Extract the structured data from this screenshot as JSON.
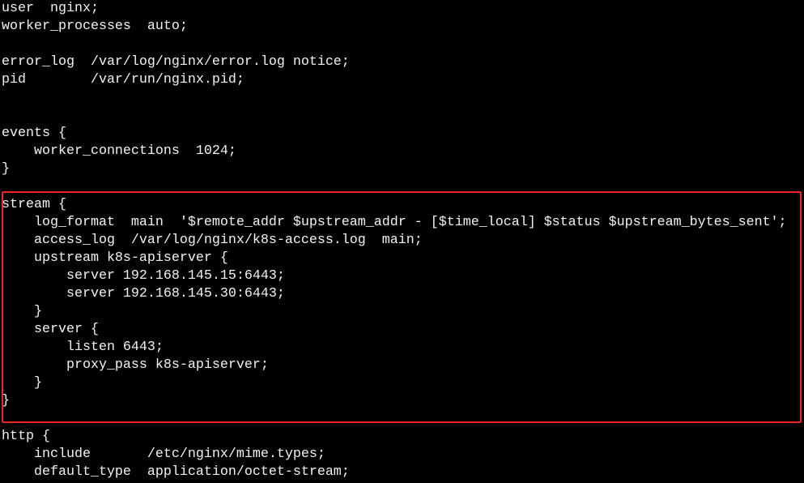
{
  "terminal": {
    "lines": [
      "user  nginx;",
      "worker_processes  auto;",
      "",
      "error_log  /var/log/nginx/error.log notice;",
      "pid        /var/run/nginx.pid;",
      "",
      "",
      "events {",
      "    worker_connections  1024;",
      "}",
      "",
      "stream {",
      "    log_format  main  '$remote_addr $upstream_addr - [$time_local] $status $upstream_bytes_sent';",
      "    access_log  /var/log/nginx/k8s-access.log  main;",
      "    upstream k8s-apiserver {",
      "        server 192.168.145.15:6443;",
      "        server 192.168.145.30:6443;",
      "    }",
      "    server {",
      "        listen 6443;",
      "        proxy_pass k8s-apiserver;",
      "    }",
      "}",
      "",
      "http {",
      "    include       /etc/nginx/mime.types;",
      "    default_type  application/octet-stream;"
    ]
  },
  "highlight": {
    "color": "#f02424",
    "label": "stream-block"
  },
  "colors": {
    "background": "#000000",
    "text": "#f2f2f2"
  }
}
